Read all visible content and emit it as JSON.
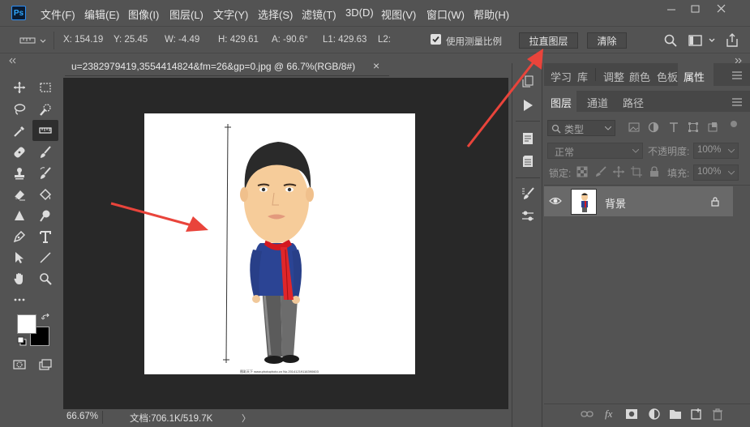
{
  "menubar": {
    "logo": "Ps",
    "items": [
      "文件(F)",
      "编辑(E)",
      "图像(I)",
      "图层(L)",
      "文字(Y)",
      "选择(S)",
      "滤镜(T)",
      "3D(D)",
      "视图(V)",
      "窗口(W)",
      "帮助(H)"
    ]
  },
  "options": {
    "x": "X: 154.19",
    "y": "Y: 25.45",
    "w": "W: -4.49",
    "h": "H: 429.61",
    "a": "A: -90.6°",
    "l1": "L1: 429.63",
    "l2": "L2:",
    "measure_scale_label": "使用测量比例",
    "straighten_label": "拉直图层",
    "clear_label": "清除"
  },
  "document": {
    "tab_title": "u=2382979419,3554414824&fm=26&gp=0.jpg @ 66.7%(RGB/8#)",
    "close_glyph": "×",
    "watermark": "图彩天下 www.photophoto.cn No.20141219116390603"
  },
  "status": {
    "zoom": "66.67%",
    "doc_info": "文档:706.1K/519.7K",
    "arrow": "〉"
  },
  "panels": {
    "top_tabs": [
      "学习",
      "库",
      "调整",
      "颜色",
      "色板",
      "属性"
    ],
    "active_top_tab": "属性",
    "layer_tabs": [
      "图层",
      "通道",
      "路径"
    ],
    "filter_kind": "类型",
    "blend_mode": "正常",
    "opacity_label": "不透明度:",
    "opacity_value": "100%",
    "lock_label": "锁定:",
    "fill_label": "填充:",
    "fill_value": "100%",
    "layer_name": "背景"
  },
  "colors": {
    "accent_arrow": "#e9443b",
    "panel_bg": "#535353",
    "canvas_bg": "#282828",
    "selected_layer": "#696969"
  }
}
